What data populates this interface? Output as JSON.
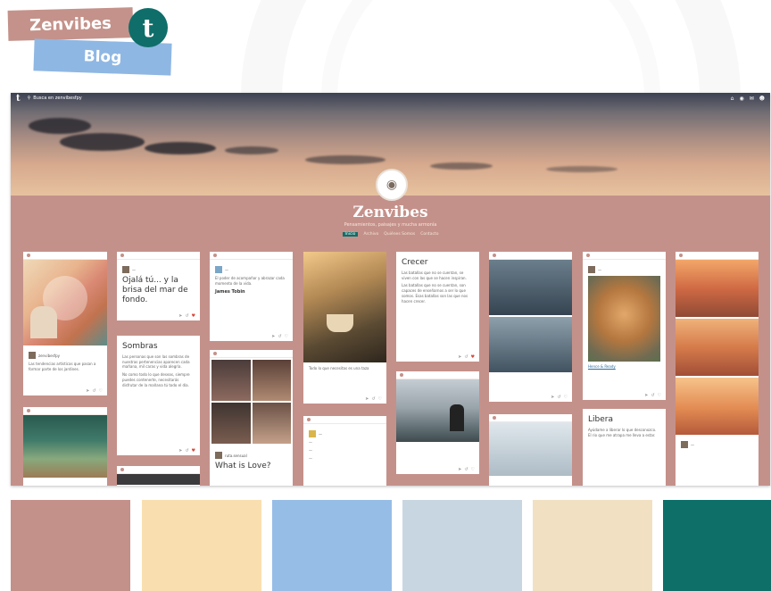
{
  "header": {
    "brand_label": "Zenvibes",
    "sub_label": "Blog",
    "badge_glyph": "t",
    "badge_icon": "tumblr-icon"
  },
  "topbar": {
    "logo": "t",
    "search_placeholder": "Busca en zenvibesfpy"
  },
  "blog": {
    "title": "Zenvibes",
    "description": "Pensamientos, paisajes y mucha armonía",
    "nav": [
      "Inicio",
      "Archivo",
      "Quiénes Somos",
      "Contacto"
    ]
  },
  "posts": {
    "p1": {
      "user": "zenvibesfpy",
      "text": "Las tendencias artísticas que pasan a formar parte de los jardines."
    },
    "p2": {
      "title": "Ojalá tú... y la brisa del mar de fondo."
    },
    "p3": {
      "title": "Sombras",
      "text1": "Las personas que son las sombras de nuestras pertenencias aparecen cada mañana, mil caras y vida alegría.",
      "text2": "No como todo lo que deseas, siempre puedes contenerte, necesitarás disfrutar de la mañana tú todo el día."
    },
    "p4": {
      "text": "El poder de acompañar y abrazar cada momento de la vida.",
      "author": "James Tobin"
    },
    "p5": {
      "title": "What is Love?",
      "user": "ruta.sensual"
    },
    "p6": {
      "caption": "Todo lo que necesitas es una taza"
    },
    "p7": {
      "title": "Crecer",
      "text1": "Las batallas que no se cuentan, se viven con las que se hacen inspiran.",
      "text2": "Las batallas que no se cuentan, son capaces de enseñarnos a ser lo que somos. Esas batallas son las que nos hacen crecer."
    },
    "p8": {
      "title": "Libera",
      "text": "Ayúdame a liberar lo que desconozco. El rio que me atrapa me lleva a estar."
    },
    "p9": {
      "link": "Hence & Ready"
    }
  },
  "swatches": [
    "#c4918a",
    "#f9dfb0",
    "#96bde6",
    "#c8d6e2",
    "#f2e0c3",
    "#0e6f69"
  ]
}
